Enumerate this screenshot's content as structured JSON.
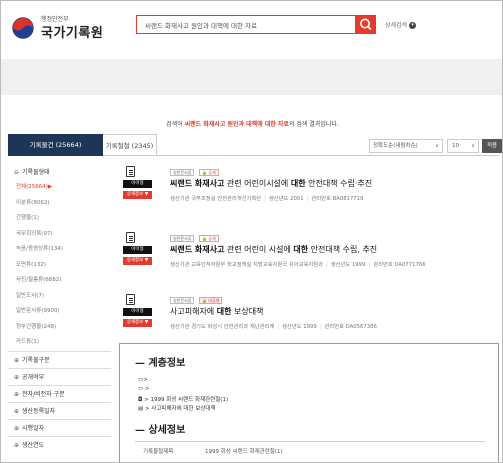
{
  "header": {
    "logo_small": "행정안전부",
    "logo_big": "국가기록원",
    "search_value": "씨랜드 화재사고 원인과 대책에 대한 자료",
    "detail_search_label": "상세검색"
  },
  "result_message": {
    "prefix": "검색어",
    "keyword": "씨랜드 화재사고 원인과 대책에 대한 자료",
    "suffix": "의 검색 결과입니다."
  },
  "tabs": [
    {
      "label": "기록물건 (25664)"
    },
    {
      "label": "기록철철 (2345)"
    }
  ],
  "controls": {
    "sort_label": "정확도순(내림차순)",
    "count_label": "10",
    "apply_label": "적용"
  },
  "sidebar": {
    "section_title": "기록물형태",
    "items": [
      {
        "label": "전체(25664)▶"
      },
      {
        "label": "이분류(8062)"
      },
      {
        "label": "간행물(1)"
      },
      {
        "label": "국무회의록(97)"
      },
      {
        "label": "녹음/동영상류(134)"
      },
      {
        "label": "도면류(132)"
      },
      {
        "label": "사진/필름류(6882)"
      },
      {
        "label": "일반도서(7)"
      },
      {
        "label": "일반문서류(9900)"
      },
      {
        "label": "정부간행물(248)"
      },
      {
        "label": "카드류(1)"
      }
    ],
    "sections": [
      {
        "label": "기록물구분"
      },
      {
        "label": "공개여부"
      },
      {
        "label": "전자/비전자 구분"
      },
      {
        "label": "생산등록일자"
      },
      {
        "label": "시행일자"
      },
      {
        "label": "생산연도"
      }
    ]
  },
  "results": [
    {
      "tag1": "일반문서류",
      "tag2": "공개",
      "badge1": "이어형",
      "badge2": "상세정보 ▼",
      "title_bold": "씨랜드 화재사고",
      "title_mid": " 관련 어린이시설에 ",
      "title_bold2": "대한",
      "title_rest": " 안전대책 수립·추진",
      "meta_org_label": "생산기관",
      "meta_org": "국무조정실 안전관리개선기획단",
      "meta_year_label": "생산년도",
      "meta_year": "2001",
      "meta_id_label": "관리번호",
      "meta_id": "BA0817719"
    },
    {
      "tag1": "일반문서류",
      "tag2": "공개",
      "badge1": "이어형",
      "badge2": "상세정보 ▼",
      "title_bold": "씨랜드 화재사고",
      "title_mid": " 관련 어린이 시설에 ",
      "title_bold2": "대한",
      "title_rest": " 안전대책 수립, 추진",
      "meta_org_label": "생산기관",
      "meta_org": "교육인적자원부 학교정책실 지방교육지원국 유아교육지원과",
      "meta_year_label": "생산년도",
      "meta_year": "1999",
      "meta_id_label": "관리번호",
      "meta_id": "DA0771766"
    },
    {
      "tag1": "일반문서류",
      "tag2": "비공개",
      "badge1": "이어형",
      "badge2": "상세정보 ▼",
      "title_bold": "",
      "title_mid": "사고피해자에 ",
      "title_bold2": "대한",
      "title_rest": " 보상대책",
      "meta_org_label": "생산기관",
      "meta_org": "경기도 화성시 안전관리과 재난관리계",
      "meta_year_label": "생산년도",
      "meta_year": "1999",
      "meta_id_label": "관리번호",
      "meta_id": "DA0567386"
    }
  ],
  "detail": {
    "hierarchy_title": "계층정보",
    "tree": [
      {
        "icon": "▭>",
        "label": ""
      },
      {
        "icon": "▭ >",
        "label": ""
      },
      {
        "icon": "◘",
        "label": "> 1999 화성 씨랜드 화재관련철(1)"
      },
      {
        "icon": "▤",
        "label": "> 사고피해자에 대한 보상대책"
      }
    ],
    "detail_title": "상세정보",
    "row_label": "기록물철제목",
    "row_value": "1999 화성 씨랜드 화재관련철(1)"
  }
}
